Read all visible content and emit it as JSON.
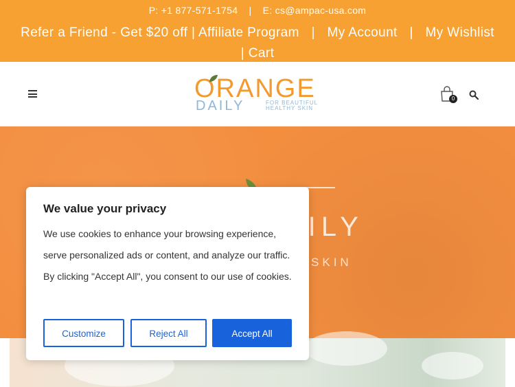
{
  "topbar": {
    "phone": "P: +1 877-571-1754",
    "separator": "|",
    "email": "E: cs@ampac-usa.com",
    "refer_link": "Refer a Friend - Get $20 off | Affiliate Program",
    "account_link": "My Account",
    "wishlist_link": "My Wishlist",
    "cart_link": "| Cart",
    "bg_color": "#f7a133"
  },
  "header": {
    "logo_top": "ORANGE",
    "logo_bottom": "DAILY",
    "logo_tagline": "FOR BEAUTIFUL HEALTHY SKIN",
    "cart_count": "0",
    "icons": [
      "menu-icon",
      "cart-icon",
      "search-icon"
    ]
  },
  "hero": {
    "title_fragment": "AILY",
    "subtitle_fragment": "HY SKIN",
    "bg_color": "#f38e3f"
  },
  "cookie": {
    "title": "We value your privacy",
    "body": "We use cookies to enhance your browsing experience, serve personalized ads or content, and analyze our traffic. By clicking \"Accept All\", you consent to our use of cookies.",
    "customize_label": "Customize",
    "reject_label": "Reject All",
    "accept_label": "Accept All",
    "accent_color": "#1863dc"
  }
}
